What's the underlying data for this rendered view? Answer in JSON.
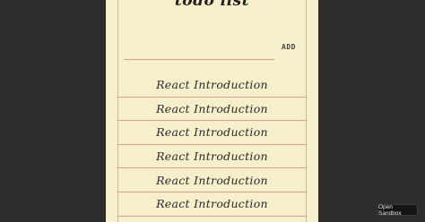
{
  "app": {
    "title": "todo list",
    "add_label": "ADD"
  },
  "todos": [
    {
      "text": "React Introduction"
    },
    {
      "text": "React Introduction"
    },
    {
      "text": "React Introduction"
    },
    {
      "text": "React Introduction"
    },
    {
      "text": "React Introduction"
    },
    {
      "text": "React Introduction"
    }
  ],
  "sandbox": {
    "label": "Open Sandbox"
  },
  "colors": {
    "background": "#2d2d2d",
    "paper": "#f6efcb",
    "rule_line": "#e29a8c",
    "margin_line": "#c9b59a",
    "ink": "#2a2a2a"
  }
}
